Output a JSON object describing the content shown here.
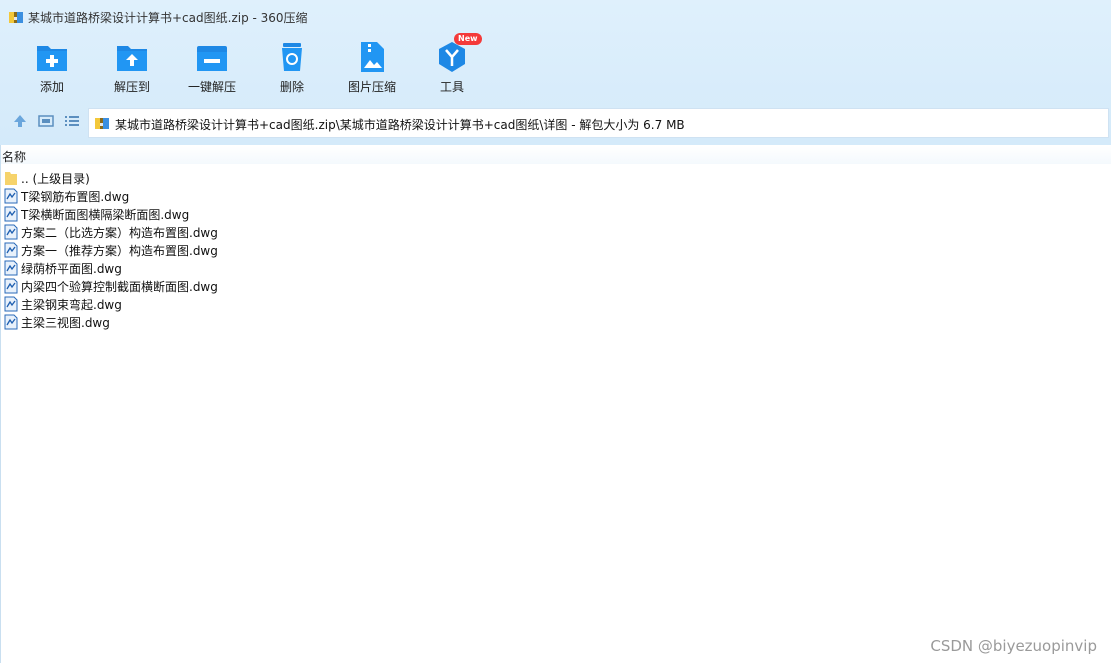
{
  "window": {
    "title": "某城市道路桥梁设计计算书+cad图纸.zip - 360压缩"
  },
  "toolbar": {
    "add": "添加",
    "extract_to": "解压到",
    "one_click_extract": "一键解压",
    "delete": "删除",
    "image_compress": "图片压缩",
    "tools": "工具",
    "tools_badge": "New"
  },
  "address": {
    "path": "某城市道路桥梁设计计算书+cad图纸.zip\\某城市道路桥梁设计计算书+cad图纸\\详图 - 解包大小为 6.7 MB"
  },
  "list": {
    "column_name": "名称",
    "parent": ".. (上级目录)",
    "files": [
      "T梁钢筋布置图.dwg",
      "T梁横断面图横隔梁断面图.dwg",
      "方案二（比选方案）构造布置图.dwg",
      "方案一（推荐方案）构造布置图.dwg",
      "绿荫桥平面图.dwg",
      "内梁四个验算控制截面横断面图.dwg",
      "主梁钢束弯起.dwg",
      "主梁三视图.dwg"
    ]
  },
  "watermark": "CSDN @biyezuopinvip",
  "colors": {
    "accent": "#1e88e5",
    "badge": "#f43a3a",
    "folder": "#f6d36b"
  }
}
